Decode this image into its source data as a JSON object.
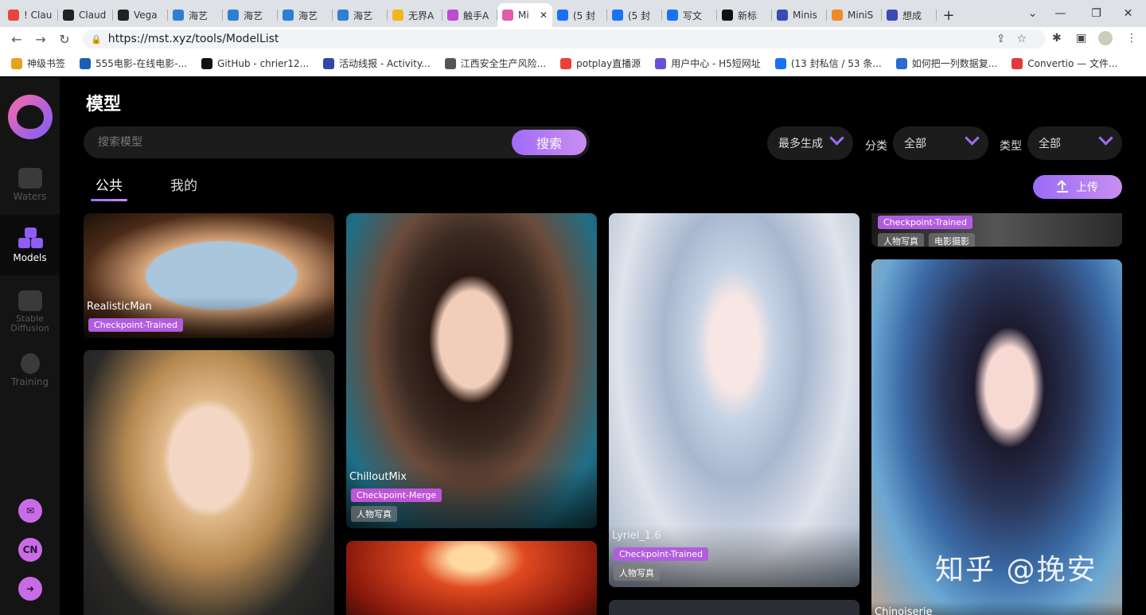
{
  "browser": {
    "tabs": [
      {
        "label": "! Clau",
        "color": "#e8453c"
      },
      {
        "label": "Claud",
        "color": "#222"
      },
      {
        "label": "Vega",
        "color": "#222"
      },
      {
        "label": "海艺",
        "color": "#2d7fd3"
      },
      {
        "label": "海艺",
        "color": "#2d7fd3"
      },
      {
        "label": "海艺",
        "color": "#2d7fd3"
      },
      {
        "label": "海艺",
        "color": "#2d7fd3"
      },
      {
        "label": "无界A",
        "color": "#f2b61d"
      },
      {
        "label": "触手A",
        "color": "#c04bd3"
      },
      {
        "label": "Mi",
        "color": "#e45ca8",
        "active": true
      },
      {
        "label": "(5 封",
        "color": "#1772f6"
      },
      {
        "label": "(5 封",
        "color": "#1772f6"
      },
      {
        "label": "写文",
        "color": "#1772f6"
      },
      {
        "label": "新标",
        "color": "#111"
      },
      {
        "label": "Minis",
        "color": "#3a4bb5"
      },
      {
        "label": "MiniS",
        "color": "#f08a24"
      },
      {
        "label": "想成",
        "color": "#3a4bb5"
      }
    ],
    "url": "https://mst.xyz/tools/ModelList",
    "bookmarks": [
      {
        "label": "神级书签",
        "color": "#e5a21a"
      },
      {
        "label": "555电影-在线电影-...",
        "color": "#1a5fb4"
      },
      {
        "label": "GitHub - chrier12...",
        "color": "#111"
      },
      {
        "label": "活动线报 - Activity...",
        "color": "#3049a8"
      },
      {
        "label": "江西安全生产风险...",
        "color": "#555"
      },
      {
        "label": "potplay直播源",
        "color": "#ea4335"
      },
      {
        "label": "用户中心 - H5短网址",
        "color": "#6c4fd8"
      },
      {
        "label": "(13 封私信 / 53 条...",
        "color": "#1772f6"
      },
      {
        "label": "如何把一列数据复...",
        "color": "#2a6bd4"
      },
      {
        "label": "Convertio — 文件...",
        "color": "#e23a3a"
      }
    ]
  },
  "sidebar": {
    "items": [
      {
        "label": "Waters"
      },
      {
        "label": "Models"
      },
      {
        "label": "Stable Diffusion"
      },
      {
        "label": "Training"
      }
    ],
    "bottom": [
      {
        "icon": "mail-icon",
        "text": "✉"
      },
      {
        "icon": "language-cn-icon",
        "text": "CN"
      },
      {
        "icon": "logout-icon",
        "text": "➜"
      }
    ]
  },
  "page": {
    "title": "模型",
    "search_placeholder": "搜索模型",
    "search_button": "搜索",
    "sort_value": "最多生成",
    "category_label": "分类",
    "category_value": "全部",
    "type_label": "类型",
    "type_value": "全部",
    "tabs": [
      "公共",
      "我的"
    ],
    "upload_label": "上传"
  },
  "cards": [
    {
      "name": "RealisticMan",
      "badge": "Checkpoint-Trained",
      "tags": []
    },
    {
      "name": "",
      "badge": "",
      "tags": []
    },
    {
      "name": "ChilloutMix",
      "badge": "Checkpoint-Merge",
      "tags": [
        "人物写真"
      ]
    },
    {
      "name": "",
      "badge": "",
      "tags": []
    },
    {
      "name": "Lyriel_1.6",
      "badge": "Checkpoint-Trained",
      "tags": [
        "人物写真"
      ]
    },
    {
      "name": "",
      "badge": "Checkpoint-Trained",
      "tags": [
        "人物写真",
        "电影摄影"
      ]
    },
    {
      "name": "Chinoiserie",
      "badge": "",
      "tags": []
    }
  ],
  "watermark": "知乎 @挽安"
}
